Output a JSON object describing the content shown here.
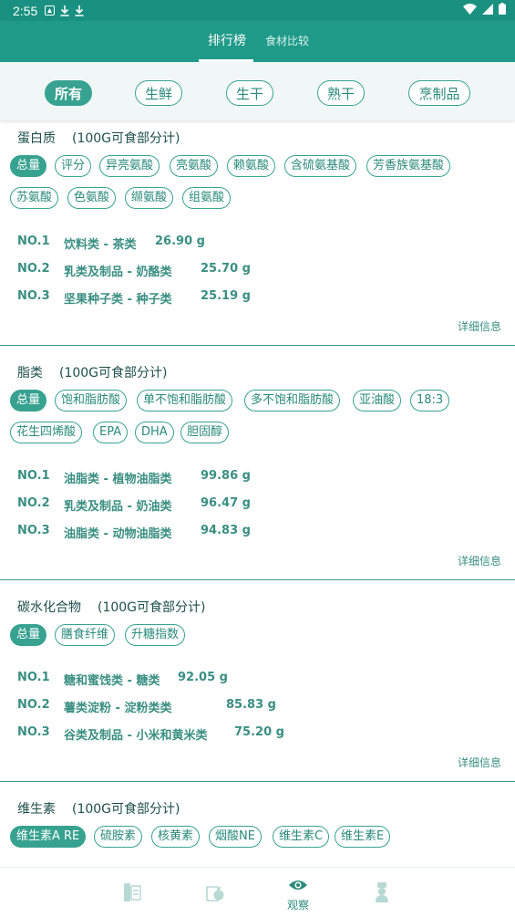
{
  "status": {
    "time": "2:55"
  },
  "tabs": [
    {
      "label": "排行榜",
      "active": true
    },
    {
      "label": "食材比较",
      "active": false
    }
  ],
  "filters": [
    {
      "label": "所有",
      "active": true
    },
    {
      "label": "生鲜",
      "active": false
    },
    {
      "label": "生干",
      "active": false
    },
    {
      "label": "熟干",
      "active": false
    },
    {
      "label": "烹制品",
      "active": false
    }
  ],
  "sections": [
    {
      "title": "蛋白质",
      "unit": "(100G可食部分计)",
      "chips": [
        "总量",
        "评分",
        "异亮氨酸",
        "亮氨酸",
        "赖氨酸",
        "含硫氨基酸",
        "芳香族氨基酸",
        "苏氨酸",
        "色氨酸",
        "缬氨酸",
        "组氨酸"
      ],
      "ranks": [
        {
          "no": "NO.1",
          "name": "饮料类 - 茶类",
          "value": "26.90 g"
        },
        {
          "no": "NO.2",
          "name": "乳类及制品 - 奶酪类",
          "value": "25.70 g"
        },
        {
          "no": "NO.3",
          "name": "坚果种子类 - 种子类",
          "value": "25.19 g"
        }
      ],
      "more": "详细信息"
    },
    {
      "title": "脂类",
      "unit": "(100G可食部分计)",
      "chips": [
        "总量",
        "饱和脂肪酸",
        "单不饱和脂肪酸",
        "多不饱和脂肪酸",
        "亚油酸",
        "18:3",
        "花生四烯酸",
        "EPA",
        "DHA",
        "胆固醇"
      ],
      "ranks": [
        {
          "no": "NO.1",
          "name": "油脂类 - 植物油脂类",
          "value": "99.86 g"
        },
        {
          "no": "NO.2",
          "name": "乳类及制品 - 奶油类",
          "value": "96.47 g"
        },
        {
          "no": "NO.3",
          "name": "油脂类 - 动物油脂类",
          "value": "94.83 g"
        }
      ],
      "more": "详细信息"
    },
    {
      "title": "碳水化合物",
      "unit": "(100G可食部分计)",
      "chips": [
        "总量",
        "膳食纤维",
        "升糖指数"
      ],
      "ranks": [
        {
          "no": "NO.1",
          "name": "糖和蜜饯类 - 糖类",
          "value": "92.05 g"
        },
        {
          "no": "NO.2",
          "name": "薯类淀粉 - 淀粉类类",
          "value": "85.83 g"
        },
        {
          "no": "NO.3",
          "name": "谷类及制品 - 小米和黄米类",
          "value": "75.20 g"
        }
      ],
      "more": "详细信息"
    },
    {
      "title": "维生素",
      "unit": "(100G可食部分计)",
      "chips": [
        "维生素A RE",
        "硫胺素",
        "核黄素",
        "烟酸NE",
        "维生素C",
        "维生素E"
      ],
      "ranks": [],
      "more": ""
    }
  ],
  "bottom_nav": [
    {
      "icon": "calculator-icon",
      "label": ""
    },
    {
      "icon": "fruit-basket-icon",
      "label": ""
    },
    {
      "icon": "eye-icon",
      "label": "观察"
    },
    {
      "icon": "chef-icon",
      "label": ""
    }
  ],
  "colors": {
    "primary": "#1f9a88",
    "accent": "#37a290",
    "text": "#1d4f4a"
  }
}
